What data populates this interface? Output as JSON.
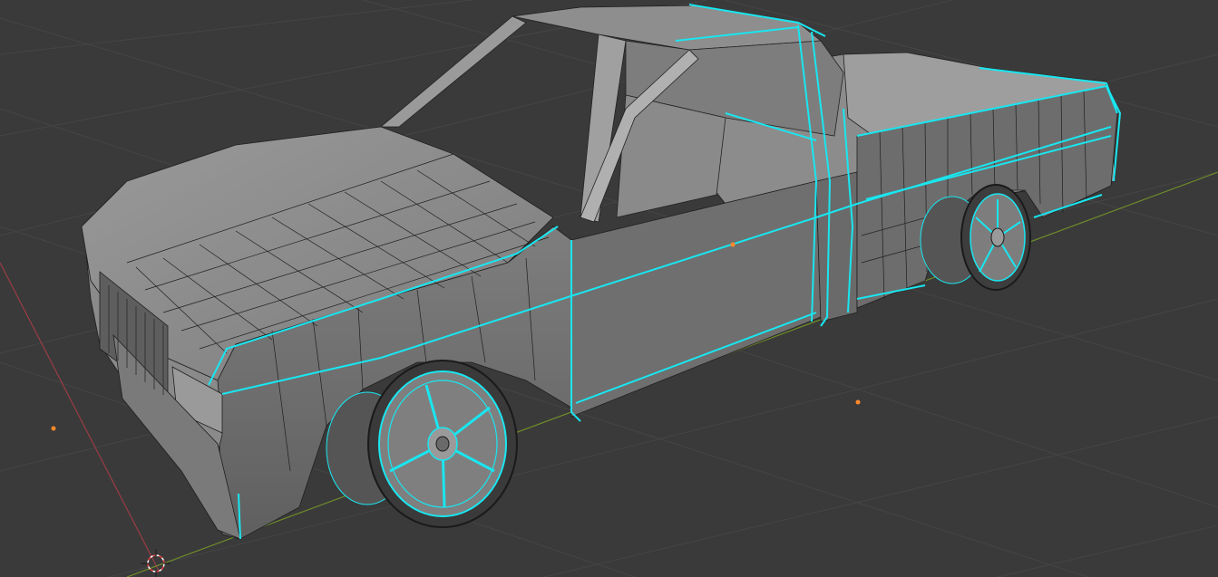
{
  "viewport": {
    "background": "#3a3a3a",
    "grid_color": "#434343",
    "axis_x_color": "#9b3c45",
    "axis_y_color": "#6e8c2a",
    "body_color": "#7a7a7a",
    "edge_color": "#1f1f1f",
    "selected_edge_color": "#19e6f0",
    "object_origin_color": "#ff8a2a",
    "cursor_color": "#ffffff"
  },
  "scene": {
    "object": "pickup-truck",
    "mode": "edit-mesh",
    "selection": "edge-loops-highlighted",
    "wheels": 2
  }
}
